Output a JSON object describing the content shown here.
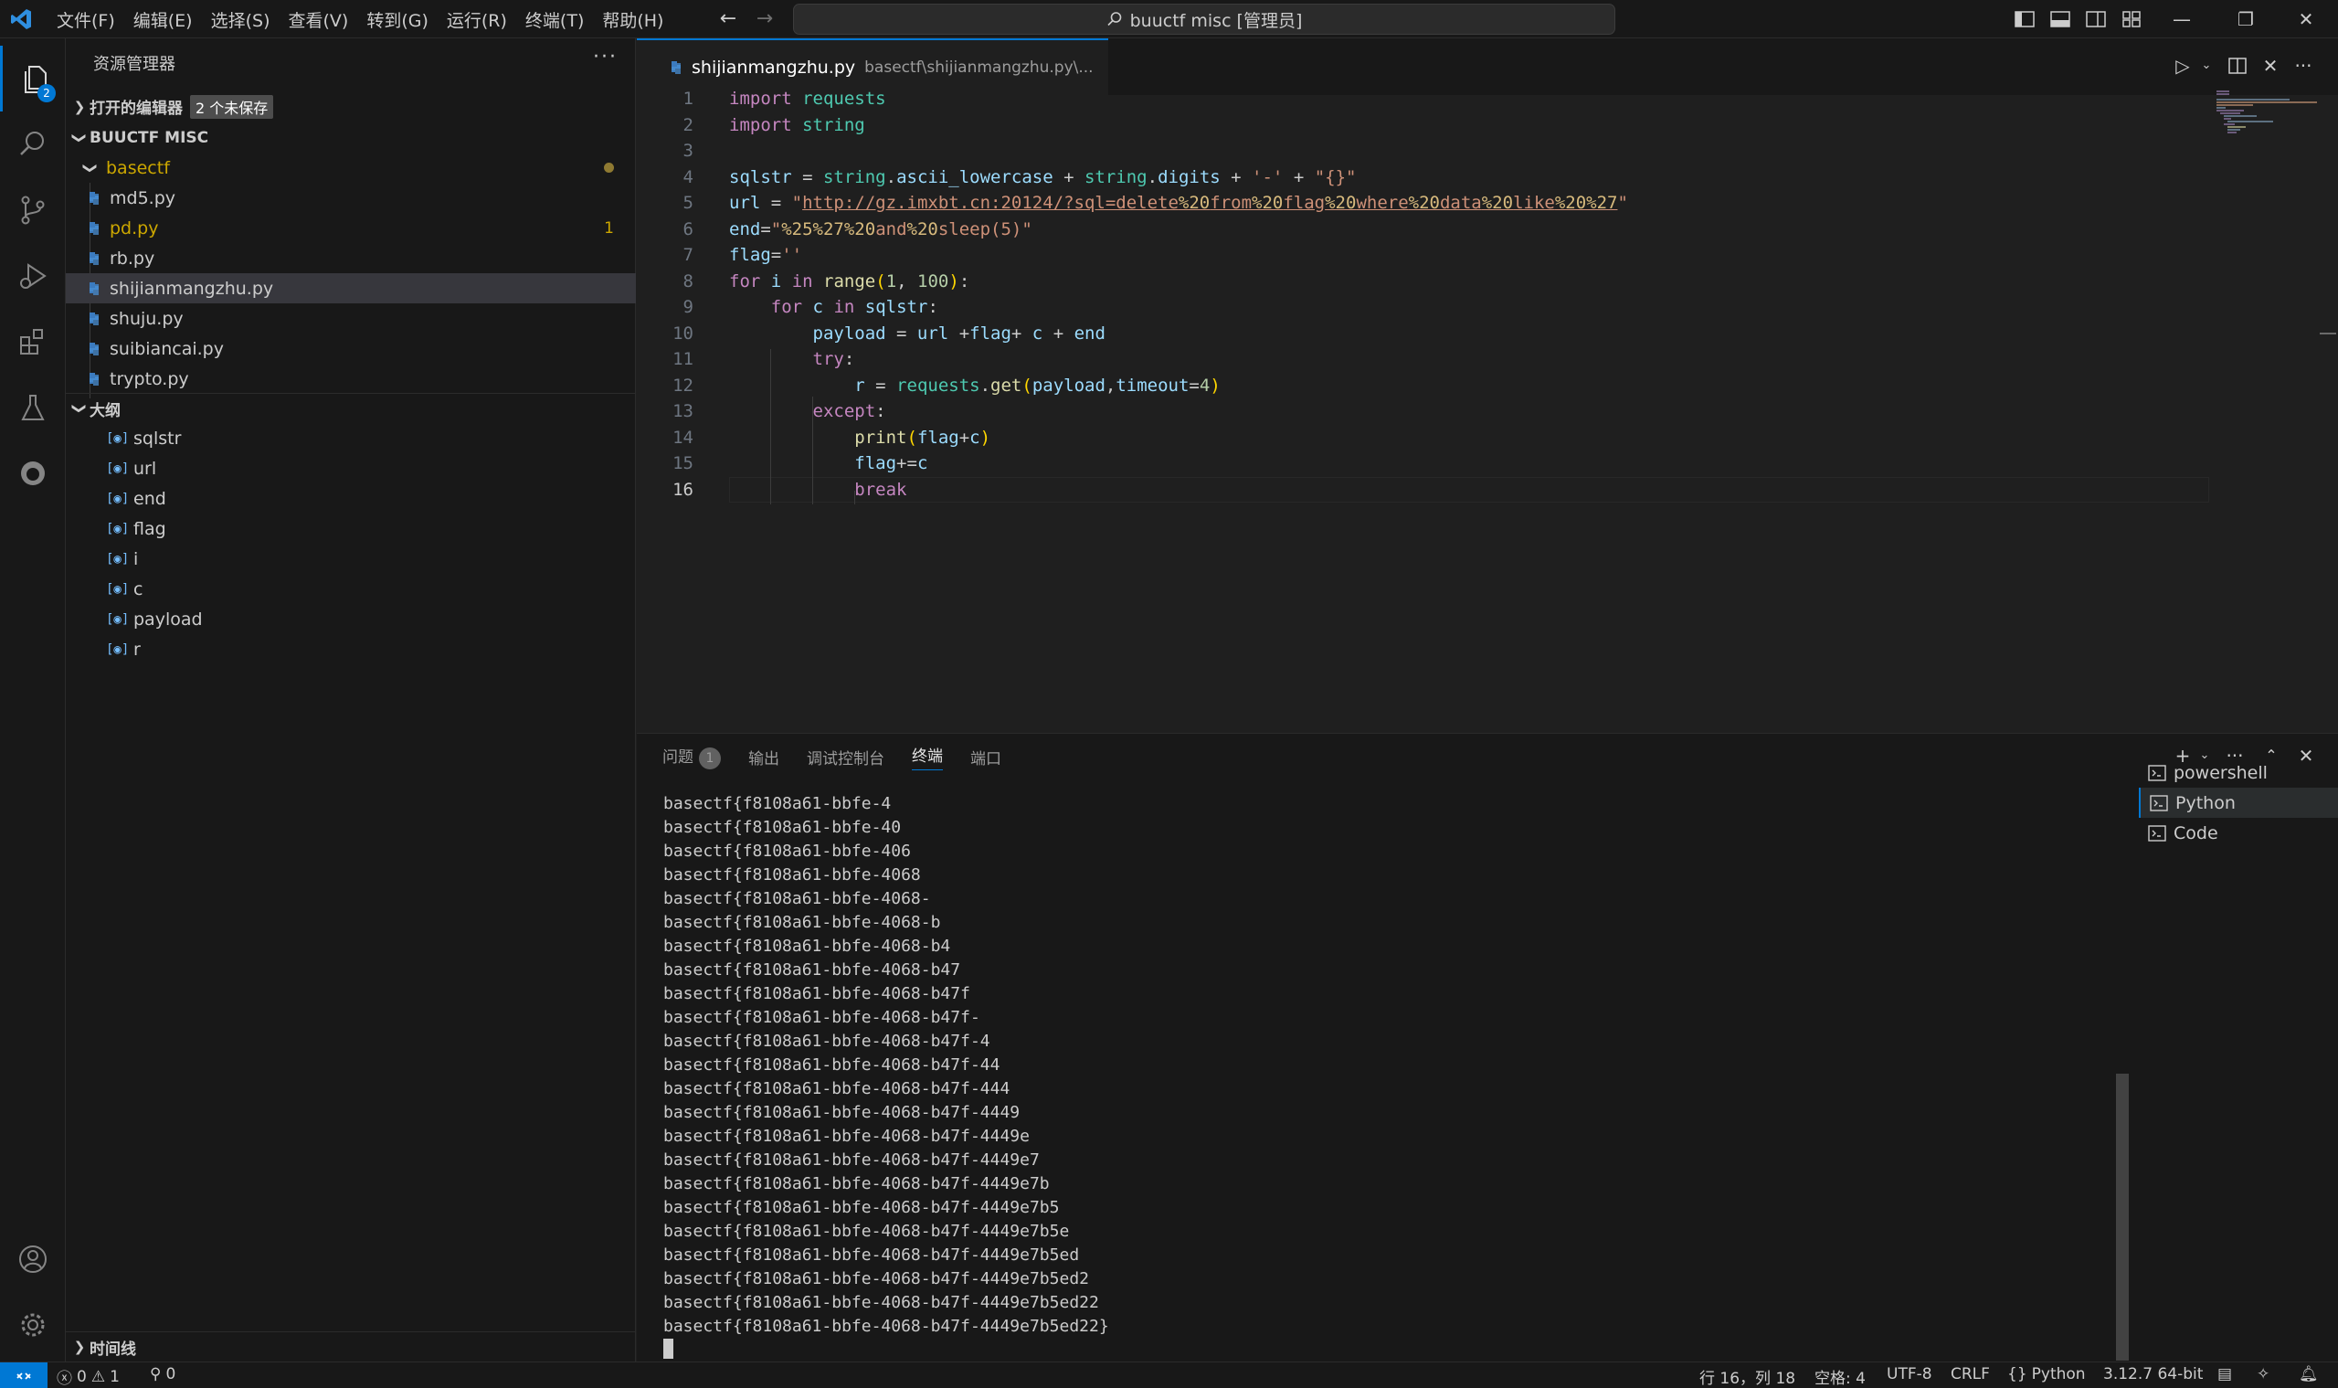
{
  "titlebar": {
    "menus": [
      "文件(F)",
      "编辑(E)",
      "选择(S)",
      "查看(V)",
      "转到(G)",
      "运行(R)",
      "终端(T)",
      "帮助(H)"
    ],
    "search_text": "buuctf misc [管理员]"
  },
  "activity": {
    "explorer_badge": "2"
  },
  "sidebar": {
    "title": "资源管理器",
    "open_editors": "打开的编辑器",
    "unsaved_badge": "2 个未保存",
    "workspace": "BUUCTF MISC",
    "folder": "basectf",
    "files": [
      {
        "name": "md5.py"
      },
      {
        "name": "pd.py",
        "problems": "1"
      },
      {
        "name": "rb.py"
      },
      {
        "name": "shijianmangzhu.py"
      },
      {
        "name": "shuju.py"
      },
      {
        "name": "suibiancai.py"
      },
      {
        "name": "trypto.py"
      }
    ],
    "outline_title": "大纲",
    "outline": [
      "sqlstr",
      "url",
      "end",
      "flag",
      "i",
      "c",
      "payload",
      "r"
    ],
    "timeline_title": "时间线"
  },
  "editor": {
    "tab_name": "shijianmangzhu.py",
    "tab_path": "basectf\\shijianmangzhu.py\\...",
    "line_numbers": [
      "1",
      "2",
      "3",
      "4",
      "5",
      "6",
      "7",
      "8",
      "9",
      "10",
      "11",
      "12",
      "13",
      "14",
      "15",
      "16"
    ]
  },
  "panel": {
    "tabs": [
      "问题",
      "输出",
      "调试控制台",
      "终端",
      "端口"
    ],
    "problems_count": "1",
    "terminal_lines": [
      "basectf{f8108a61-bbfe-4",
      "basectf{f8108a61-bbfe-40",
      "basectf{f8108a61-bbfe-406",
      "basectf{f8108a61-bbfe-4068",
      "basectf{f8108a61-bbfe-4068-",
      "basectf{f8108a61-bbfe-4068-b",
      "basectf{f8108a61-bbfe-4068-b4",
      "basectf{f8108a61-bbfe-4068-b47",
      "basectf{f8108a61-bbfe-4068-b47f",
      "basectf{f8108a61-bbfe-4068-b47f-",
      "basectf{f8108a61-bbfe-4068-b47f-4",
      "basectf{f8108a61-bbfe-4068-b47f-44",
      "basectf{f8108a61-bbfe-4068-b47f-444",
      "basectf{f8108a61-bbfe-4068-b47f-4449",
      "basectf{f8108a61-bbfe-4068-b47f-4449e",
      "basectf{f8108a61-bbfe-4068-b47f-4449e7",
      "basectf{f8108a61-bbfe-4068-b47f-4449e7b",
      "basectf{f8108a61-bbfe-4068-b47f-4449e7b5",
      "basectf{f8108a61-bbfe-4068-b47f-4449e7b5e",
      "basectf{f8108a61-bbfe-4068-b47f-4449e7b5ed",
      "basectf{f8108a61-bbfe-4068-b47f-4449e7b5ed2",
      "basectf{f8108a61-bbfe-4068-b47f-4449e7b5ed22",
      "basectf{f8108a61-bbfe-4068-b47f-4449e7b5ed22}"
    ],
    "terminals": [
      "powershell",
      "Python",
      "Code"
    ]
  },
  "statusbar": {
    "errors": "0",
    "warnings": "1",
    "ports": "0",
    "position": "行 16，列 18",
    "spaces": "空格: 4",
    "encoding": "UTF-8",
    "eol": "CRLF",
    "language": "Python",
    "interpreter": "3.12.7 64-bit"
  },
  "colors": {
    "accent": "#0078d4",
    "background": "#1f1f1f",
    "sidebar": "#181818"
  }
}
